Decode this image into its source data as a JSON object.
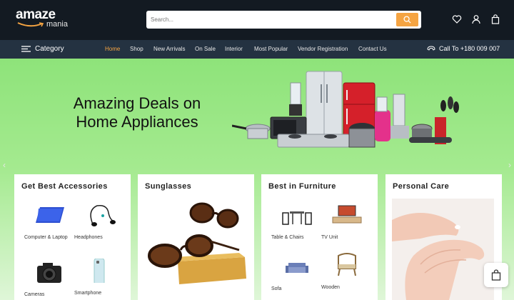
{
  "header": {
    "logo_main": "amaze",
    "logo_sub": "mania",
    "search_placeholder": "Search...",
    "icons": [
      "heart-icon",
      "user-icon",
      "bag-icon"
    ]
  },
  "nav": {
    "category_label": "Category",
    "links": [
      "Home",
      "Shop",
      "New Arrivals",
      "On Sale",
      "Interior",
      "Most Popular",
      "Vendor Registration",
      "Contact Us"
    ],
    "active": "Home",
    "call_label": "Call To +180 009 007"
  },
  "hero": {
    "title_line1": "Amazing Deals on",
    "title_line2": "Home Appliances",
    "prev_arrow": "‹",
    "next_arrow": "›"
  },
  "cards": [
    {
      "title": "Get Best Accessories",
      "items": [
        "Computer & Laptop",
        "Headphones",
        "Cameras",
        "Smartphone"
      ]
    },
    {
      "title": "Sunglasses"
    },
    {
      "title": "Best in Furniture",
      "items": [
        "Table & Chairs",
        "TV Unit",
        "Sofa",
        "Wooden"
      ]
    },
    {
      "title": "Personal Care"
    }
  ],
  "colors": {
    "accent": "#f5a442",
    "topbar": "#131a22",
    "navbar": "#243241",
    "hero": "#8ee37a"
  }
}
